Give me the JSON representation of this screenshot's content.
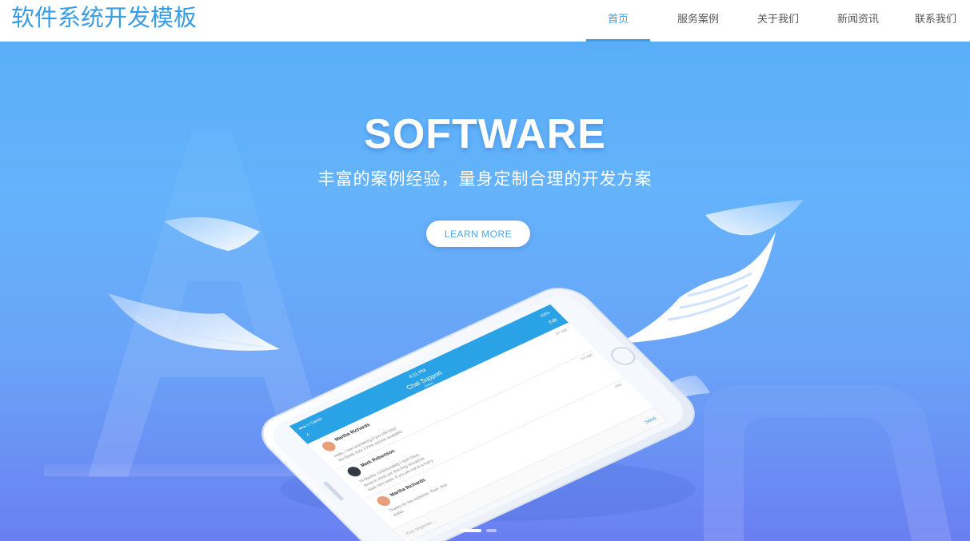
{
  "header": {
    "logo_text": "软件系统开发模板",
    "nav": [
      {
        "label": "首页",
        "active": true
      },
      {
        "label": "服务案例",
        "active": false
      },
      {
        "label": "关于我们",
        "active": false
      },
      {
        "label": "新闻资讯",
        "active": false
      },
      {
        "label": "联系我们",
        "active": false
      }
    ]
  },
  "hero": {
    "title": "SOFTWARE",
    "subtitle": "丰富的案例经验，量身定制合理的开发方案",
    "button_label": "LEARN MORE",
    "slides_count": 2,
    "active_slide": 1
  },
  "phone": {
    "status_time": "4:21 PM",
    "status_carrier": "●●●○○ Carrier",
    "status_battery": "100%",
    "title": "Chat Support",
    "title_sub": "Online",
    "right_label": "Edit",
    "messages": [
      {
        "name": "Martha Richards",
        "time": "2m ago",
        "text1": "Hello, I was wondering if you still have",
        "text2": "the Beats Solo 3 Pink version available."
      },
      {
        "name": "Mark Robertson",
        "time": "1m ago",
        "text1": "Hi Martha. Unfortunately I don't have",
        "text2": "those in stock yet. But they should be",
        "text3": "back next week, if you are not in a hurry."
      },
      {
        "name": "Martha Richards",
        "time": "now",
        "text1": "Thanks for the response. Yeah, that",
        "text2": "works."
      }
    ],
    "input_placeholder": "Your response...",
    "send_label": "Send"
  },
  "colors": {
    "accent": "#3a9de3",
    "hero_top": "#5aaef8",
    "hero_bottom": "#6a7ff2"
  }
}
